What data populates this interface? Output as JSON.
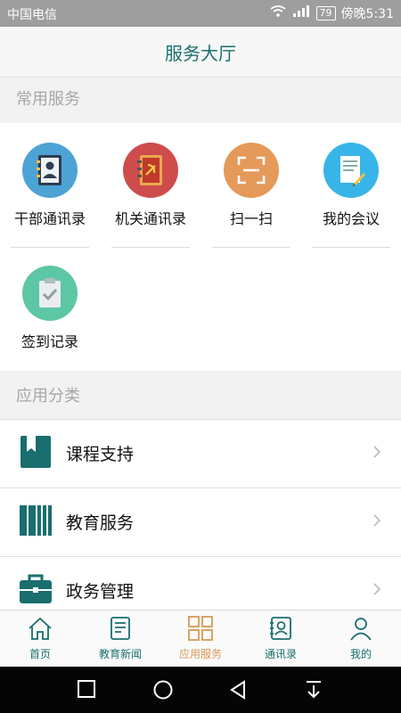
{
  "status": {
    "carrier": "中国电信",
    "battery": "79",
    "time": "傍晚5:31"
  },
  "header": {
    "title": "服务大厅"
  },
  "sections": {
    "common": "常用服务",
    "categories": "应用分类"
  },
  "tiles": [
    {
      "label": "干部通讯录",
      "color": "#4da3d4",
      "icon": "contact-book-icon"
    },
    {
      "label": "机关通讯录",
      "color": "#cf4c4c",
      "icon": "party-book-icon"
    },
    {
      "label": "扫一扫",
      "color": "#e59a5a",
      "icon": "scan-icon"
    },
    {
      "label": "我的会议",
      "color": "#38b5e8",
      "icon": "meeting-notes-icon"
    },
    {
      "label": "签到记录",
      "color": "#5dc7a5",
      "icon": "checkin-clipboard-icon"
    }
  ],
  "rows": [
    {
      "label": "课程支持",
      "icon": "book-icon"
    },
    {
      "label": "教育服务",
      "icon": "books-icon"
    },
    {
      "label": "政务管理",
      "icon": "briefcase-icon"
    }
  ],
  "tabs": [
    {
      "label": "首页",
      "icon": "home-icon",
      "active": false
    },
    {
      "label": "教育新闻",
      "icon": "news-icon",
      "active": false
    },
    {
      "label": "应用服务",
      "icon": "apps-icon",
      "active": true
    },
    {
      "label": "通讯录",
      "icon": "contacts-icon",
      "active": false
    },
    {
      "label": "我的",
      "icon": "profile-icon",
      "active": false
    }
  ],
  "colors": {
    "primary": "#1a6e6e",
    "active_tab": "#d59a58"
  }
}
